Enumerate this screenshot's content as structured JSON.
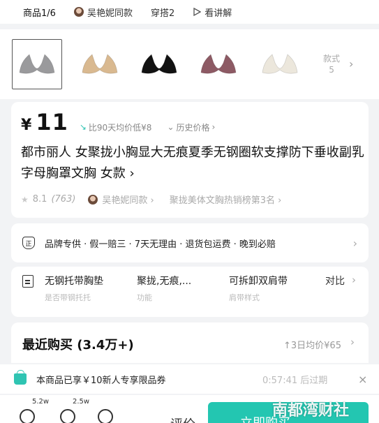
{
  "tabs": [
    {
      "label": "商品1/6"
    },
    {
      "label": "吴艳妮同款"
    },
    {
      "label": "穿搭2"
    },
    {
      "label": "看讲解"
    }
  ],
  "thumbnails": {
    "colors": [
      "#9a9a9c",
      "#d9b990",
      "#121212",
      "#8d5a64",
      "#ece7dc"
    ],
    "more_label": "款式",
    "more_count": "5"
  },
  "product": {
    "currency": "¥",
    "price": "11",
    "compare_text": "比90天均价低¥8",
    "history_label": "历史价格",
    "title": "都市丽人 女聚拢小胸显大无痕夏季无钢圈软支撑防下垂收副乳字母胸罩文胸 女款 ›",
    "rating": "8.1",
    "review_count": "(763)",
    "celebrity_tag": "吴艳妮同款 ›",
    "rank_text": "聚拢美体文胸热销榜第3名 ›"
  },
  "guarantee": {
    "text": "品牌专供 · 假一赔三 · 7天无理由 · 退货包运费 · 晚到必赔"
  },
  "params": [
    {
      "value": "无钢托带胸垫",
      "label": "是否带钢托托"
    },
    {
      "value": "聚拢,无痕,...",
      "label": "功能"
    },
    {
      "value": "可拆卸双肩带",
      "label": "肩带样式"
    }
  ],
  "compare_btn": "对比",
  "recent": {
    "title": "最近购买 (3.4万+)",
    "avg_text": "↑3日均价¥65"
  },
  "coupon": {
    "text": "本商品已享￥10新人专享限品券",
    "countdown": "0:57:41 后过期",
    "close": "×"
  },
  "bottom": {
    "badge1": "5.2w",
    "badge2": "2.5w",
    "mid_label": "评价",
    "cta_label": "立即购买"
  },
  "watermark": "南都湾财社",
  "accent_color": "#23c6b1"
}
